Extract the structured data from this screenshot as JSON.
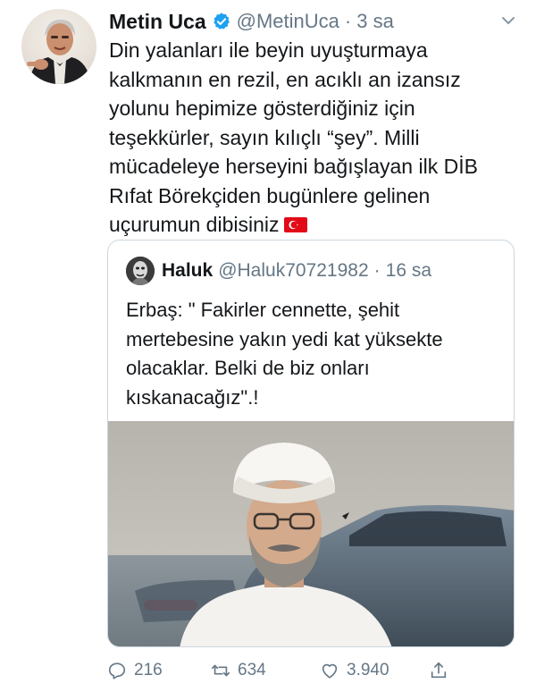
{
  "tweet": {
    "author": {
      "name": "Metin Uca",
      "handle": "@MetinUca",
      "separator": "·",
      "time": "3 sa",
      "verified": true,
      "avatar_icon": "profile-photo"
    },
    "text": "Din yalanları ile beyin uyuşturmaya kalkmanın en rezil, en acıklı an izansız yolunu hepimize gösterdiğiniz için teşekkürler, sayın kılıçlı “şey”. Milli mücadeleye herseyini bağışlayan ilk DİB Rıfat Börekçiden bugünlere gelinen uçurumun dibisiniz",
    "emoji": "turkey-flag-icon",
    "menu_icon": "chevron-down-icon",
    "accent_color": "#1da1f2"
  },
  "quoted": {
    "author": {
      "name": "Haluk",
      "handle": "@Haluk70721982",
      "separator": "·",
      "time": "16 sa"
    },
    "text": "Erbaş: \" Fakirler cennette, şehit mertebesine yakın yedi kat yüksekte olacaklar. Belki de biz onları kıskanacağız\".!",
    "media": "photo"
  },
  "actions": {
    "reply": {
      "icon": "reply-icon",
      "count": "216"
    },
    "retweet": {
      "icon": "retweet-icon",
      "count": "634"
    },
    "like": {
      "icon": "heart-icon",
      "count": "3.940"
    },
    "share": {
      "icon": "share-icon"
    }
  }
}
